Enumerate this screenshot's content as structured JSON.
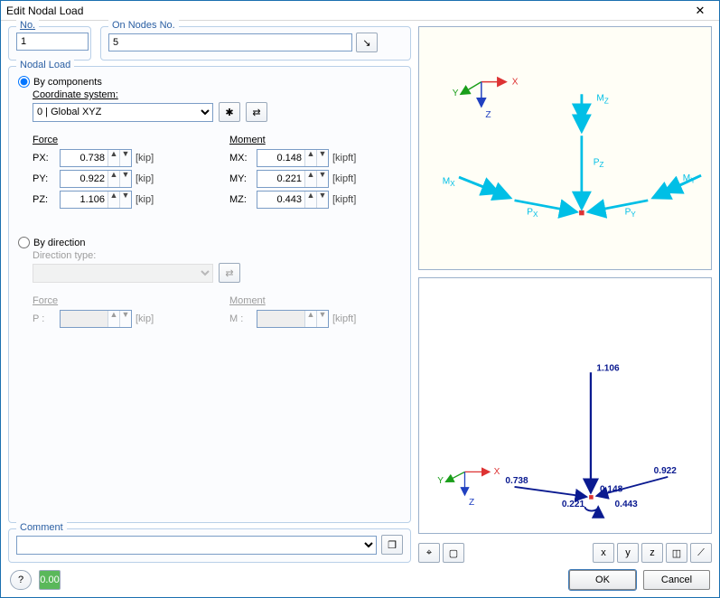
{
  "window": {
    "title": "Edit Nodal Load"
  },
  "top": {
    "no_label": "No.",
    "no_value": "1",
    "nodes_label": "On Nodes No.",
    "nodes_value": "5"
  },
  "nodal": {
    "group_label": "Nodal Load",
    "by_components": "By components",
    "coord_label": "Coordinate system:",
    "coord_value": "0 | Global XYZ",
    "force_head": "Force",
    "moment_head": "Moment",
    "px_label": "PX:",
    "px_val": "0.738",
    "px_unit": "[kip]",
    "py_label": "PY:",
    "py_val": "0.922",
    "py_unit": "[kip]",
    "pz_label": "PZ:",
    "pz_val": "1.106",
    "pz_unit": "[kip]",
    "mx_label": "MX:",
    "mx_val": "0.148",
    "mx_unit": "[kipft]",
    "my_label": "MY:",
    "my_val": "0.221",
    "my_unit": "[kipft]",
    "mz_label": "MZ:",
    "mz_val": "0.443",
    "mz_unit": "[kipft]",
    "by_direction": "By direction",
    "dir_type_label": "Direction type:",
    "force2_head": "Force",
    "moment2_head": "Moment",
    "p_label": "P :",
    "p_unit": "[kip]",
    "m_label": "M :",
    "m_unit": "[kipft]"
  },
  "comment": {
    "group_label": "Comment"
  },
  "preview": {
    "axis_x": "X",
    "axis_y": "Y",
    "axis_z": "Z",
    "MZ": "M",
    "PZ": "P",
    "MX": "M",
    "MY": "M",
    "PX": "P",
    "PY": "P",
    "v1": "1.106",
    "v2": "0.738",
    "v3": "0.148",
    "v4": "0.221",
    "v5": "0.922",
    "v6": "0.443"
  },
  "buttons": {
    "ok": "OK",
    "cancel": "Cancel"
  },
  "icons": {
    "pick": "↘",
    "new": "✱",
    "link": "⇄",
    "help": "?",
    "units": "0.00",
    "stack": "❐",
    "v1": "⌖",
    "v2": "▢",
    "vx": "x",
    "vy": "y",
    "vz": "z",
    "iso": "◫",
    "persp": "⟋"
  }
}
